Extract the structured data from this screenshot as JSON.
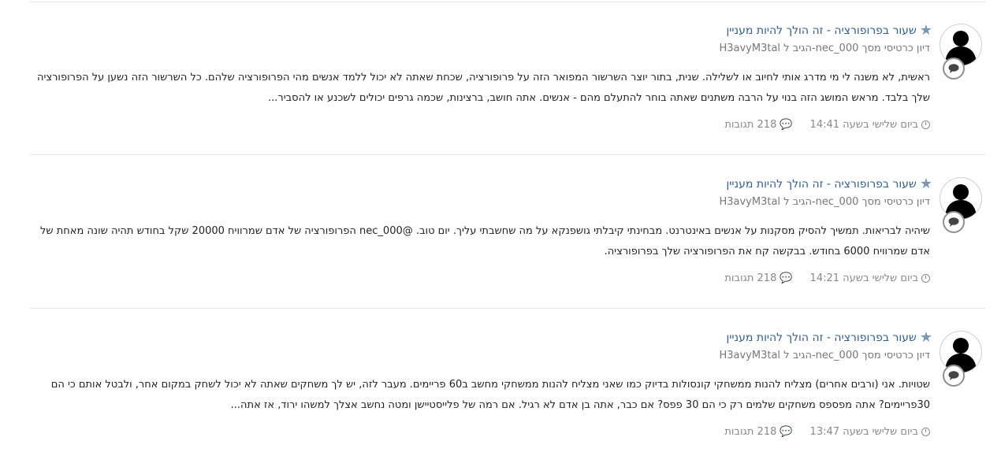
{
  "posts": [
    {
      "title": "שעור בפרופורציה - זה הולך להיות מעניין",
      "meta": "H3avyM3tal הגיב ל-nec_000 דיון כרטיסי מסך",
      "excerpt": "ראשית, לא משנה לי מי מדרג אותי לחיוב או לשלילה. שנית, בתור יוצר השרשור המפואר הזה על פרופורציה, שכחת שאתה לא יכול ללמד אנשים מהי הפרופורציה שלהם. כל השרשור הזה נשען על הפרופורציה שלך בלבד. מראש המושג הזה בנוי על הרבה משתנים שאתה בוחר להתעלם מהם - אנשים. אתה חושב, ברצינות, שכמה גרפים יכולים לשכנע או להסביר...",
      "time": "ביום שלישי בשעה 14:41",
      "replies": "218 תגובות"
    },
    {
      "title": "שעור בפרופורציה - זה הולך להיות מעניין",
      "meta": "H3avyM3tal הגיב ל-nec_000 דיון כרטיסי מסך",
      "excerpt": "שיהיה לבריאות. תמשיך להסיק מסקנות על אנשים באינטרנט. מבחינתי קיבלתי גושפנקא על מה שחשבתי עליך. יום טוב. @nec_000 הפרופורציה של אדם שמרוויח 20000 שקל בחודש תהיה שונה מאחת של אדם שמרוויח 6000 בחודש. בבקשה קח את הפרופורציה שלך בפרופורציה.",
      "time": "ביום שלישי בשעה 14:21",
      "replies": "218 תגובות"
    },
    {
      "title": "שעור בפרופורציה - זה הולך להיות מעניין",
      "meta": "H3avyM3tal הגיב ל-nec_000 דיון כרטיסי מסך",
      "excerpt": "שטויות. אני (ורבים אחרים) מצליח להנות ממשחקי קונסולות בדיוק כמו שאני מצליח להנות ממשחקי מחשב ב60 פריימים. מעבר לזה, יש לך משחקים שאתה לא יכול לשחק במקום אחר, ולבטל אותם כי הם 30פריימים? אתה מפספס משחקים שלמים רק כי הם 30 פפס? אם כבר, אתה בן אדם לא רגיל. אם רמה של פלייסטיישן ומטה נחשב אצלך למשהו ירוד, אז אתה...",
      "time": "ביום שלישי בשעה 13:47",
      "replies": "218 תגובות"
    }
  ],
  "colors": {
    "link": "#2e5d90",
    "muted": "#888888",
    "star": "#7b97b3"
  }
}
